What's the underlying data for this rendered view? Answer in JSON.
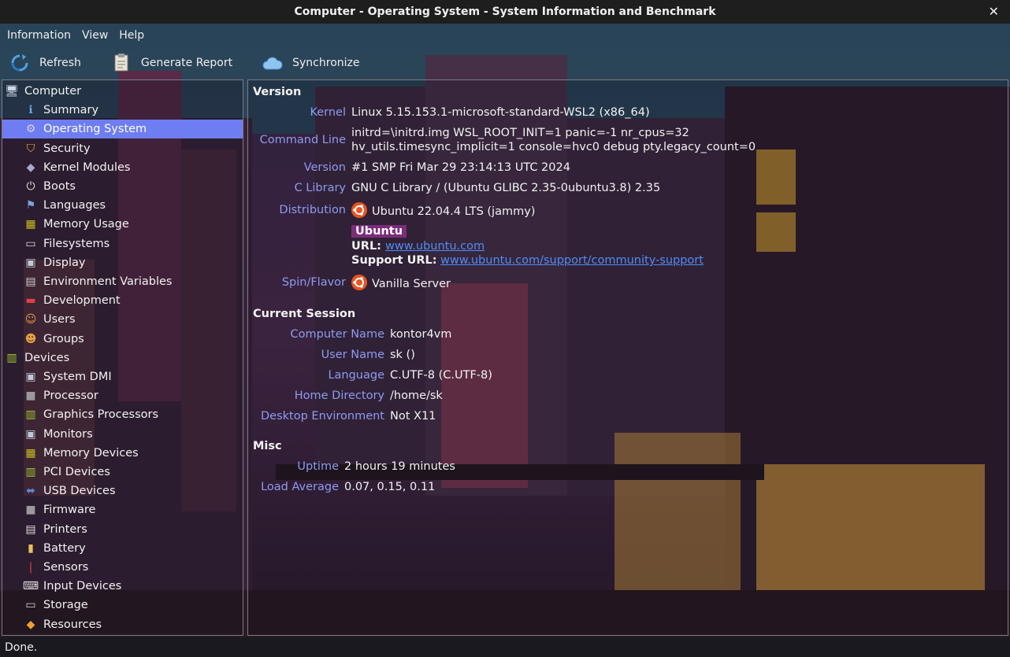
{
  "window": {
    "title": "Computer - Operating System - System Information and Benchmark",
    "close_glyph": "✕"
  },
  "menu": [
    "Information",
    "View",
    "Help"
  ],
  "toolbar": {
    "refresh": "Refresh",
    "report": "Generate Report",
    "sync": "Synchronize"
  },
  "sidebar": {
    "selected": "Operating System",
    "items": [
      {
        "label": "Computer",
        "icon": "computer-icon",
        "level": 0
      },
      {
        "label": "Summary",
        "icon": "info-icon",
        "level": 1
      },
      {
        "label": "Operating System",
        "icon": "gear-icon",
        "level": 1
      },
      {
        "label": "Security",
        "icon": "shield-icon",
        "level": 1
      },
      {
        "label": "Kernel Modules",
        "icon": "module-icon",
        "level": 1
      },
      {
        "label": "Boots",
        "icon": "power-icon",
        "level": 1
      },
      {
        "label": "Languages",
        "icon": "flag-icon",
        "level": 1
      },
      {
        "label": "Memory Usage",
        "icon": "chip-icon",
        "level": 1
      },
      {
        "label": "Filesystems",
        "icon": "drive-icon",
        "level": 1
      },
      {
        "label": "Display",
        "icon": "monitor-icon",
        "level": 1
      },
      {
        "label": "Environment Variables",
        "icon": "terminal-icon",
        "level": 1
      },
      {
        "label": "Development",
        "icon": "toolbox-icon",
        "level": 1
      },
      {
        "label": "Users",
        "icon": "users-icon",
        "level": 1
      },
      {
        "label": "Groups",
        "icon": "group-icon",
        "level": 1
      },
      {
        "label": "Devices",
        "icon": "board-icon",
        "level": 0
      },
      {
        "label": "System DMI",
        "icon": "monitor-icon",
        "level": 1
      },
      {
        "label": "Processor",
        "icon": "cpu-icon",
        "level": 1
      },
      {
        "label": "Graphics Processors",
        "icon": "board-icon",
        "level": 1
      },
      {
        "label": "Monitors",
        "icon": "monitor-icon",
        "level": 1
      },
      {
        "label": "Memory Devices",
        "icon": "chip-icon",
        "level": 1
      },
      {
        "label": "PCI Devices",
        "icon": "board-icon",
        "level": 1
      },
      {
        "label": "USB Devices",
        "icon": "usb-icon",
        "level": 1
      },
      {
        "label": "Firmware",
        "icon": "cpu-icon",
        "level": 1
      },
      {
        "label": "Printers",
        "icon": "printer-icon",
        "level": 1
      },
      {
        "label": "Battery",
        "icon": "battery-icon",
        "level": 1
      },
      {
        "label": "Sensors",
        "icon": "thermometer-icon",
        "level": 1
      },
      {
        "label": "Input Devices",
        "icon": "keyboard-icon",
        "level": 1
      },
      {
        "label": "Storage",
        "icon": "drive-icon",
        "level": 1
      },
      {
        "label": "Resources",
        "icon": "diamond-icon",
        "level": 1
      }
    ]
  },
  "main": {
    "version": {
      "heading": "Version",
      "kernel_label": "Kernel",
      "kernel": "Linux 5.15.153.1-microsoft-standard-WSL2 (x86_64)",
      "cmdline_label": "Command Line",
      "cmdline_1": "initrd=\\initrd.img WSL_ROOT_INIT=1 panic=-1 nr_cpus=32",
      "cmdline_2": "hv_utils.timesync_implicit=1 console=hvc0 debug pty.legacy_count=0",
      "version_label": "Version",
      "version": "#1 SMP Fri Mar 29 23:14:13 UTC 2024",
      "clib_label": "C Library",
      "clib": "GNU C Library / (Ubuntu GLIBC 2.35-0ubuntu3.8) 2.35",
      "distro_label": "Distribution",
      "distro": "Ubuntu 22.04.4 LTS (jammy)",
      "badge": "Ubuntu",
      "url_label": "URL:",
      "url": "www.ubuntu.com",
      "support_label": "Support URL:",
      "support_url": "www.ubuntu.com/support/community-support",
      "flavor_label": "Spin/Flavor",
      "flavor": "Vanilla Server"
    },
    "session": {
      "heading": "Current Session",
      "computer_label": "Computer Name",
      "computer": "kontor4vm",
      "user_label": "User Name",
      "user": "sk ()",
      "lang_label": "Language",
      "lang": "C.UTF-8 (C.UTF-8)",
      "home_label": "Home Directory",
      "home": "/home/sk",
      "de_label": "Desktop Environment",
      "de": "Not X11"
    },
    "misc": {
      "heading": "Misc",
      "uptime_label": "Uptime",
      "uptime": "2 hours 19 minutes",
      "load_label": "Load Average",
      "load": "0.07, 0.15, 0.11"
    }
  },
  "status": "Done.",
  "colors": {
    "selection": "#6f7df2",
    "label": "#8e9bf0",
    "link": "#4f8df5",
    "badge": "#7b2d7a",
    "ubuntu": "#e95420"
  }
}
